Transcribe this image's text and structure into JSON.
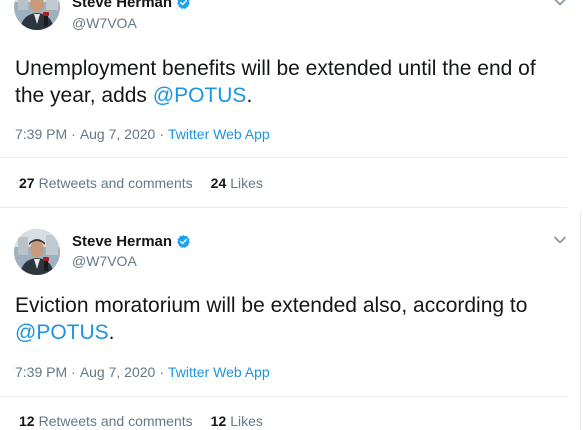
{
  "tweets": [
    {
      "author": {
        "name": "Steve Herman",
        "handle": "@W7VOA"
      },
      "text": "Unemployment benefits will be extended until the end of the year, adds ",
      "mention": "@POTUS",
      "text_end": ".",
      "time": "7:39 PM",
      "date": "Aug 7, 2020",
      "separator": "·",
      "source": "Twitter Web App",
      "retweets_count": "27",
      "retweets_label": "Retweets and comments",
      "likes_count": "24",
      "likes_label": "Likes"
    },
    {
      "author": {
        "name": "Steve Herman",
        "handle": "@W7VOA"
      },
      "text": "Eviction moratorium will be extended also, according to ",
      "mention": "@POTUS",
      "text_end": ".",
      "time": "7:39 PM",
      "date": "Aug 7, 2020",
      "separator": "·",
      "source": "Twitter Web App",
      "retweets_count": "12",
      "retweets_label": "Retweets and comments",
      "likes_count": "12",
      "likes_label": "Likes"
    }
  ],
  "colors": {
    "link": "#1b95e0",
    "verified": "#1da1f2",
    "muted": "#657786",
    "text": "#14171a",
    "divider": "#e6ecf0"
  },
  "icons": {
    "verified": "verified-badge-icon",
    "chevron": "chevron-down-icon",
    "avatar": "profile-photo"
  }
}
